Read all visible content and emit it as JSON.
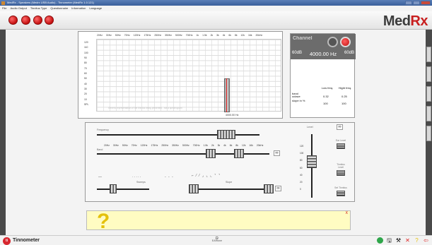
{
  "window": {
    "title": "MedRx - Speakers (Medrx USB Audio) - Tinnometer (MedRx 1.0.121)"
  },
  "menu": [
    "File",
    "Audio Output",
    "Tinnitus Type",
    "Questionnaire",
    "Information",
    "Language"
  ],
  "brand": {
    "name": "Med",
    "rx": "Rx"
  },
  "spectrum": {
    "freq_labels": [
      "20Hz",
      "30Hz",
      "50Hz",
      "70Hz",
      "120Hz",
      "175Hz",
      "250Hz",
      "350Hz",
      "500Hz",
      "700Hz",
      "1k",
      "1.5k",
      "2k",
      "3k",
      "4k",
      "6k",
      "8k",
      "12k",
      "16k",
      "20kHz"
    ],
    "y_labels": [
      "120",
      "110",
      "100",
      "90",
      "80",
      "70",
      "60",
      "50",
      "40",
      "30",
      "20",
      "10",
      "SPL"
    ],
    "note": "Generic representation of the tinnitus being presented - not a spectrogram",
    "center_freq": "4000.00 Hz"
  },
  "info": {
    "mode": "Channel",
    "left_level": "60dB",
    "frequency": "4000.00 Hz",
    "right_level": "60dB",
    "low_freq_label": "Low freq.",
    "high_freq_label": "Hight freq.",
    "row1_label": "band octave",
    "row1_low": "0.32",
    "row1_high": "0.25",
    "row2_label": "slope in %",
    "row2_low": "100",
    "row2_high": "100"
  },
  "controls": {
    "frequency_label": "Frequency",
    "band_label": "Band",
    "freq_labels": [
      "20Hz",
      "30Hz",
      "50Hz",
      "70Hz",
      "120Hz",
      "175Hz",
      "250Hz",
      "350Hz",
      "500Hz",
      "700Hz",
      "1.5k",
      "2k",
      "3k",
      "4k",
      "6k",
      "8k",
      "12k",
      "16k",
      "20kHz"
    ],
    "sweeps_label": "Sweeps",
    "slope_label": "Slope",
    "level_label": "Level",
    "level_ticks": [
      "120",
      "100",
      "80",
      "60",
      "40",
      "20",
      "0"
    ],
    "link_glyph": "∞"
  },
  "right_controls": [
    {
      "label": "Ear",
      "icon": "link-icon"
    },
    {
      "label": "Ear Level",
      "icon": "ear-level-icon"
    },
    {
      "label": "Tinnitus Level",
      "icon": "tinnitus-level-icon"
    },
    {
      "label": "Set Tinnitus",
      "icon": "set-tinnitus-icon"
    }
  ],
  "help": {
    "symbol": "?",
    "close": "X"
  },
  "status": {
    "logo_letters": "ti",
    "company": "Tinnometer",
    "eartone_label": "EARtone",
    "icons": [
      "status-ok-icon",
      "save-icon",
      "settings-icon",
      "close-x-icon",
      "help-icon",
      "back-icon"
    ]
  },
  "colors": {
    "accent_red": "#c81f1f",
    "help_bg": "#fffcc2",
    "status_green": "#2ea64a"
  }
}
